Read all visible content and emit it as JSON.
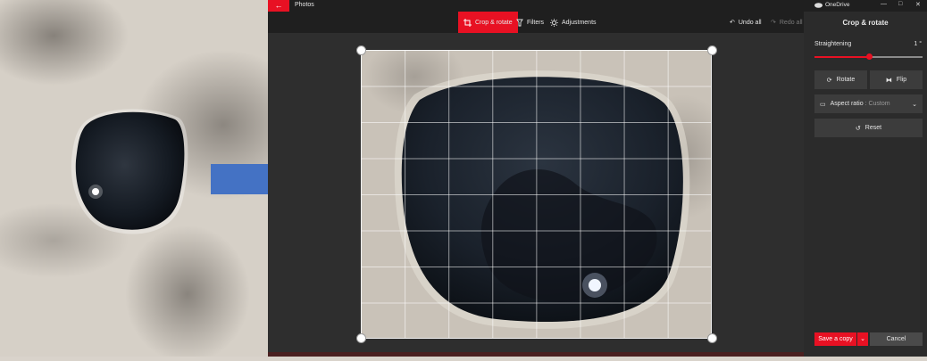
{
  "app": {
    "title": "Photos",
    "back_icon": "arrow-left-icon"
  },
  "toolbar": {
    "crop_rotate": "Crop & rotate",
    "filters": "Filters",
    "adjustments": "Adjustments",
    "undo_all": "Undo all",
    "redo_all": "Redo all"
  },
  "window": {
    "title": "OneDrive",
    "minimize": "—",
    "maximize": "□",
    "close": "✕"
  },
  "panel": {
    "title": "Crop & rotate",
    "straightening_label": "Straightening",
    "straightening_value": "1 °",
    "straightening_fraction": 0.5,
    "rotate_label": "Rotate",
    "flip_label": "Flip",
    "aspect_label": "Aspect ratio",
    "aspect_separator": " : ",
    "aspect_value": "Custom",
    "reset_label": "Reset",
    "save_label": "Save a copy",
    "save_chevron": "⌄",
    "cancel_label": "Cancel"
  },
  "colors": {
    "accent": "#e81123",
    "toolbar_bg": "#1f1f1f",
    "panel_bg": "#2b2b2b",
    "button_bg": "#3c3c3c",
    "arrow_fill": "#4472c4"
  }
}
